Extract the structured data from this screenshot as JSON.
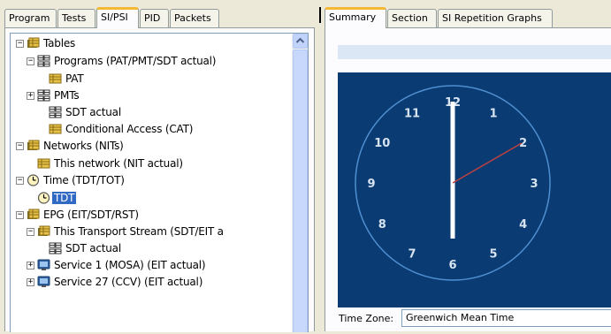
{
  "left_tabs": [
    {
      "label": "Program",
      "active": false
    },
    {
      "label": "Tests",
      "active": false
    },
    {
      "label": "SI/PSI",
      "active": true
    },
    {
      "label": "PID",
      "active": false
    },
    {
      "label": "Packets",
      "active": false
    }
  ],
  "right_tabs": [
    {
      "label": "Summary",
      "active": true
    },
    {
      "label": "Section",
      "active": false
    },
    {
      "label": "SI Repetition Graphs",
      "active": false
    }
  ],
  "tree": [
    {
      "label": "Tables",
      "icon": "folder-table-icon",
      "expander": "−"
    },
    {
      "label": "Programs (PAT/PMT/SDT actual)",
      "icon": "grid-icon",
      "expander": "−"
    },
    {
      "label": "PAT",
      "icon": "table-icon",
      "expander": ""
    },
    {
      "label": "PMTs",
      "icon": "grid-icon",
      "expander": "+"
    },
    {
      "label": "SDT actual",
      "icon": "grid-icon",
      "expander": ""
    },
    {
      "label": "Conditional Access (CAT)",
      "icon": "table-icon",
      "expander": ""
    },
    {
      "label": "Networks (NITs)",
      "icon": "folder-table-icon",
      "expander": "−"
    },
    {
      "label": "This network (NIT actual)",
      "icon": "table-icon",
      "expander": ""
    },
    {
      "label": "Time (TDT/TOT)",
      "icon": "clock-icon",
      "expander": "−"
    },
    {
      "label": "TDT",
      "icon": "clock-icon",
      "expander": "",
      "selected": true
    },
    {
      "label": "EPG (EIT/SDT/RST)",
      "icon": "folder-table-icon",
      "expander": "−"
    },
    {
      "label": "This Transport Stream (SDT/EIT a",
      "icon": "folder-table-icon",
      "expander": "−"
    },
    {
      "label": "SDT actual",
      "icon": "grid-icon",
      "expander": ""
    },
    {
      "label": "Service 1 (MOSA) (EIT actual)",
      "icon": "monitor-icon",
      "expander": "+"
    },
    {
      "label": "Service 27 (CCV) (EIT actual)",
      "icon": "monitor-icon",
      "expander": "+"
    }
  ],
  "clock": {
    "numerals": [
      "12",
      "1",
      "2",
      "3",
      "4",
      "5",
      "6",
      "7",
      "8",
      "9",
      "10",
      "11"
    ],
    "hour": 12,
    "minute": 0,
    "second": 10
  },
  "time_zone": {
    "label": "Time Zone:",
    "value": "Greenwich Mean Time"
  },
  "colors": {
    "clock_bg": "#0a3c73",
    "clock_ring": "#4f8fd0",
    "second_hand": "#c04040",
    "selection": "#316ac5"
  }
}
